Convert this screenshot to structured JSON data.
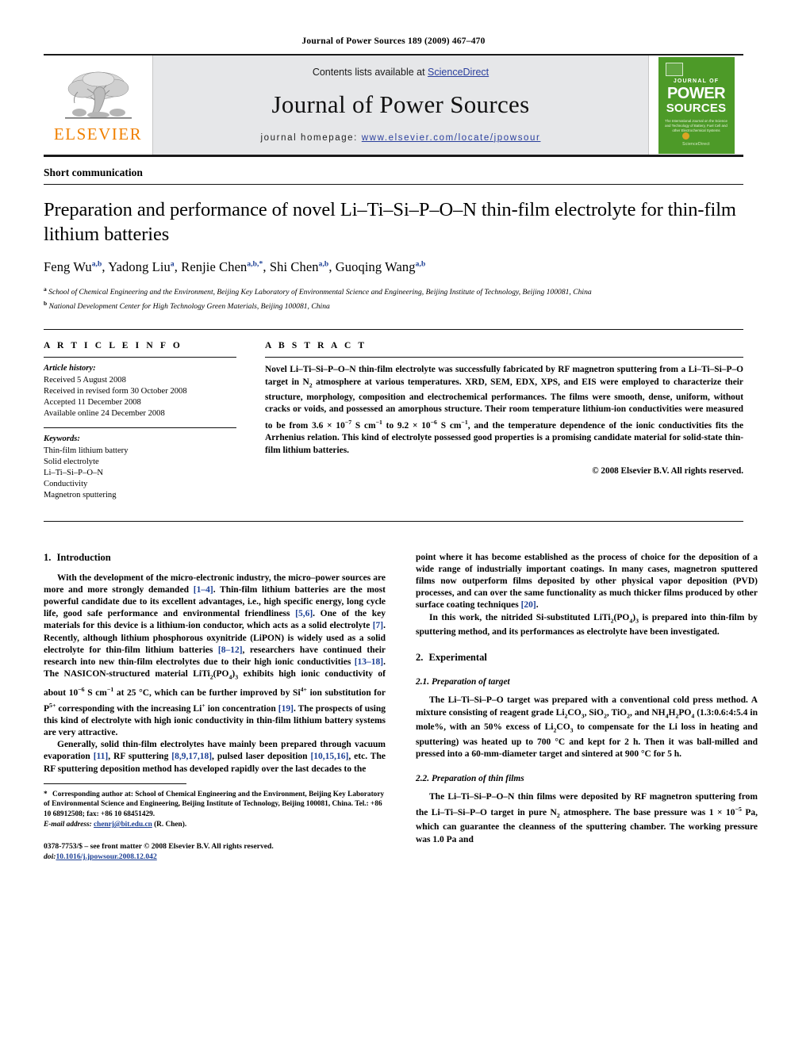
{
  "running_head": "Journal of Power Sources 189 (2009) 467–470",
  "masthead": {
    "publisher_name": "ELSEVIER",
    "contents_prefix": "Contents lists available at ",
    "contents_link": "ScienceDirect",
    "journal_title": "Journal of Power Sources",
    "homepage_prefix": "journal homepage: ",
    "homepage_url": "www.elsevier.com/locate/jpowsour",
    "cover": {
      "line1": "JOURNAL OF",
      "line2": "POWER",
      "line3": "SOURCES",
      "subtitle": "The International Journal on the Science and Technology of Battery, Fuel Cell and other Electrochemical Systems",
      "footer": "ScienceDirect"
    },
    "colors": {
      "link_blue": "#2a3f9d",
      "elsevier_orange": "#f08000",
      "cover_green": "#4d9a28",
      "masthead_gray": "#e6e7e9"
    }
  },
  "article": {
    "kind": "Short communication",
    "title": "Preparation and performance of novel Li–Ti–Si–P–O–N thin-film electrolyte for thin-film lithium batteries",
    "authors_plain": "Feng Wu a,b, Yadong Liu a, Renjie Chen a,b,*, Shi Chen a,b, Guoqing Wang a,b",
    "authors": [
      {
        "name": "Feng Wu",
        "marks": "a,b"
      },
      {
        "name": "Yadong Liu",
        "marks": "a"
      },
      {
        "name": "Renjie Chen",
        "marks": "a,b,*"
      },
      {
        "name": "Shi Chen",
        "marks": "a,b"
      },
      {
        "name": "Guoqing Wang",
        "marks": "a,b"
      }
    ],
    "affiliations": [
      {
        "mark": "a",
        "text": "School of Chemical Engineering and the Environment, Beijing Key Laboratory of Environmental Science and Engineering, Beijing Institute of Technology, Beijing 100081, China"
      },
      {
        "mark": "b",
        "text": "National Development Center for High Technology Green Materials, Beijing 100081, China"
      }
    ]
  },
  "article_info": {
    "heading": "A R T I C L E    I N F O",
    "history_label": "Article history:",
    "history": [
      "Received 5 August 2008",
      "Received in revised form 30 October 2008",
      "Accepted 11 December 2008",
      "Available online 24 December 2008"
    ],
    "keywords_label": "Keywords:",
    "keywords": [
      "Thin-film lithium battery",
      "Solid electrolyte",
      "Li–Ti–Si–P–O–N",
      "Conductivity",
      "Magnetron sputtering"
    ]
  },
  "abstract": {
    "heading": "A B S T R A C T",
    "text_html": "Novel Li–Ti–Si–P–O–N thin-film electrolyte was successfully fabricated by RF magnetron sputtering from a Li–Ti–Si–P–O target in N<sub>2</sub> atmosphere at various temperatures. XRD, SEM, EDX, XPS, and EIS were employed to characterize their structure, morphology, composition and electrochemical performances. The films were smooth, dense, uniform, without cracks or voids, and possessed an amorphous structure. Their room temperature lithium-ion conductivities were measured to be from 3.6 × 10<sup>−7</sup> S cm<sup>−1</sup> to 9.2 × 10<sup>−6</sup> S cm<sup>−1</sup>, and the temperature dependence of the ionic conductivities fits the Arrhenius relation. This kind of electrolyte possessed good properties is a promising candidate material for solid-state thin-film lithium batteries.",
    "copyright": "© 2008 Elsevier B.V. All rights reserved."
  },
  "sections": {
    "intro": {
      "number": "1.",
      "title": "Introduction",
      "p1_html": "With the development of the micro-electronic industry, the micro–power sources are more and more strongly demanded <span class=\"cit\">[1–4]</span>. Thin-film lithium batteries are the most powerful candidate due to its excellent advantages, i.e., high specific energy, long cycle life, good safe performance and environmental friendliness <span class=\"cit\">[5,6]</span>. One of the key materials for this device is a lithium-ion conductor, which acts as a solid electrolyte <span class=\"cit\">[7]</span>. Recently, although lithium phosphorous oxynitride (LiPON) is widely used as a solid electrolyte for thin-film lithium batteries <span class=\"cit\">[8–12]</span>, researchers have continued their research into new thin-film electrolytes due to their high ionic conductivities <span class=\"cit\">[13–18]</span>. The NASICON-structured material LiTi<sub>2</sub>(PO<sub>4</sub>)<sub>3</sub> exhibits high ionic conductivity of about 10<sup>−6</sup> S cm<sup>−1</sup> at 25 °C, which can be further improved by Si<sup>4+</sup> ion substitution for P<sup>5+</sup> corresponding with the increasing Li<sup>+</sup> ion concentration <span class=\"cit\">[19]</span>. The prospects of using this kind of electrolyte with high ionic conductivity in thin-film lithium battery systems are very attractive.",
      "p2_html": "Generally, solid thin-film electrolytes have mainly been prepared through vacuum evaporation <span class=\"cit\">[11]</span>, RF sputtering <span class=\"cit\">[8,9,17,18]</span>, pulsed laser deposition <span class=\"cit\">[10,15,16]</span>, etc. The RF sputtering deposition method has developed rapidly over the last decades to the",
      "p3_html": "point where it has become established as the process of choice for the deposition of a wide range of industrially important coatings. In many cases, magnetron sputtered films now outperform films deposited by other physical vapor deposition (PVD) processes, and can over the same functionality as much thicker films produced by other surface coating techniques <span class=\"cit\">[20]</span>.",
      "p4_html": "In this work, the nitrided Si-substituted LiTi<sub>2</sub>(PO<sub>4</sub>)<sub>3</sub> is prepared into thin-film by sputtering method, and its performances as electrolyte have been investigated."
    },
    "experimental": {
      "number": "2.",
      "title": "Experimental",
      "sub1": {
        "number": "2.1.",
        "title": "Preparation of target",
        "p1_html": "The Li–Ti–Si–P–O target was prepared with a conventional cold press method. A mixture consisting of reagent grade Li<sub>2</sub>CO<sub>3</sub>, SiO<sub>2</sub>, TiO<sub>2</sub>, and NH<sub>4</sub>H<sub>2</sub>PO<sub>4</sub> (1.3:0.6:4:5.4 in mole%, with an 50% excess of Li<sub>2</sub>CO<sub>3</sub> to compensate for the Li loss in heating and sputtering) was heated up to 700 °C and kept for 2 h. Then it was ball-milled and pressed into a 60-mm-diameter target and sintered at 900 °C for 5 h."
      },
      "sub2": {
        "number": "2.2.",
        "title": "Preparation of thin films",
        "p1_html": "The Li–Ti–Si–P–O–N thin films were deposited by RF magnetron sputtering from the Li–Ti–Si–P–O target in pure N<sub>2</sub> atmosphere. The base pressure was 1 × 10<sup>−5</sup> Pa, which can guarantee the cleanness of the sputtering chamber. The working pressure was 1.0 Pa and"
      }
    }
  },
  "footnotes": {
    "corresponding_html": "<span class=\"star\">*</span> Corresponding author at: School of Chemical Engineering and the Environment, Beijing Key Laboratory of Environmental Science and Engineering, Beijing Institute of Technology, Beijing 100081, China. Tel.: +86 10 68912508; fax: +86 10 68451429.",
    "email_label": "E-mail address:",
    "email": "chenrj@bit.edu.cn",
    "email_suffix": " (R. Chen).",
    "issn_html": "0378-7753/$ – see front matter © 2008 Elsevier B.V. All rights reserved.",
    "doi_label": "doi:",
    "doi": "10.1016/j.jpowsour.2008.12.042"
  }
}
